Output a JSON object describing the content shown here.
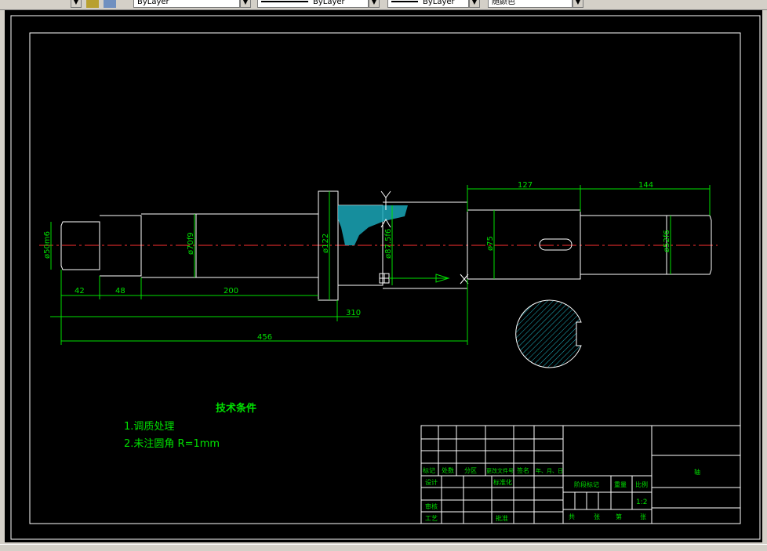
{
  "toolbar": {
    "layer_color": "ByLayer",
    "linetype": "ByLayer",
    "lineweight": "ByLayer",
    "plot_style": "随颜色"
  },
  "drawing": {
    "dims": {
      "d127": "127",
      "d144": "144",
      "d42": "42",
      "d48": "48",
      "d200": "200",
      "d310": "310",
      "d456": "456"
    },
    "diameters": {
      "d50": "ø50m6",
      "d70": "ø70f9",
      "d122": "ø122",
      "d87": "ø87.5f6",
      "d75": "ø75",
      "d52": "ø52f6"
    },
    "notes": {
      "title": "技术条件",
      "line1": "1.调质处理",
      "line2": "2.未注圆角 R=1mm"
    },
    "titleblock": {
      "mark": "标记",
      "count": "处数",
      "zone": "分区",
      "doc_no": "更改文件号",
      "sign": "签名",
      "date": "年、月、日",
      "design": "设计",
      "standard": "标准化",
      "stage_mark": "阶段标记",
      "weight": "重量",
      "scale_label": "比例",
      "scale": "1:2",
      "review": "审核",
      "process": "工艺",
      "approve": "批准",
      "total": "共",
      "sheets": "张",
      "page": "第",
      "sheet": "张",
      "part_name": "轴"
    }
  }
}
